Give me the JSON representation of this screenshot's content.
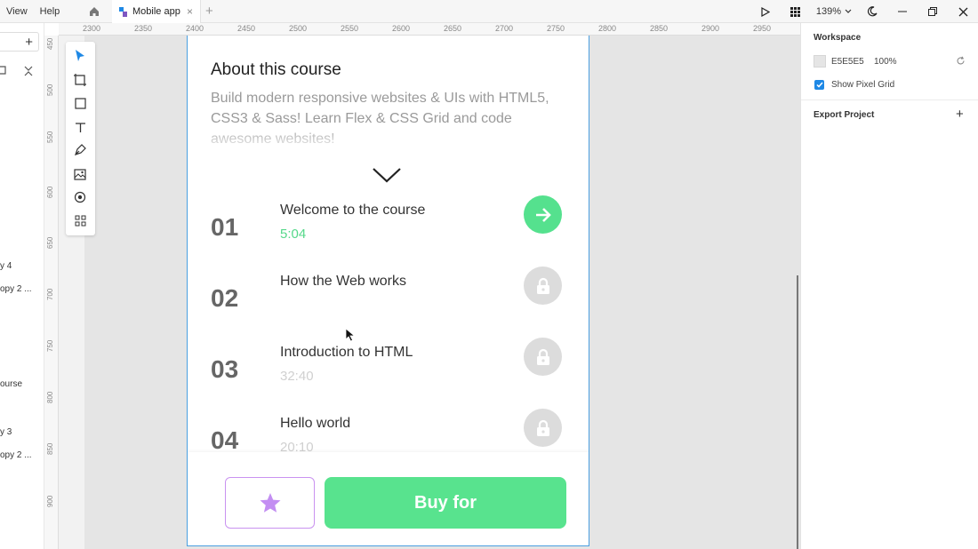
{
  "menu": [
    "View",
    "Help"
  ],
  "tab": {
    "title": "Mobile app",
    "close": "×"
  },
  "new_tab": "+",
  "zoom": {
    "value": "139%"
  },
  "left_panel": {
    "add": "+",
    "layers": [
      "y 4",
      "opy 2 ...",
      "ourse",
      "y 3",
      "opy 2 ..."
    ]
  },
  "ruler": {
    "horizontal": [
      "2300",
      "2350",
      "2400",
      "2450",
      "2500",
      "2550",
      "2600",
      "2650",
      "2700",
      "2750",
      "2800",
      "2850",
      "2900",
      "2950"
    ],
    "vertical": [
      "450",
      "500",
      "550",
      "600",
      "650",
      "700",
      "750",
      "800",
      "850",
      "900"
    ]
  },
  "artboard": {
    "about_title": "About this course",
    "about_desc": "Build modern responsive websites & UIs with HTML5, CSS3 & Sass! Learn Flex & CSS Grid and code awesome websites!",
    "lessons": [
      {
        "num": "01",
        "title": "Welcome to the course",
        "time": "5:04",
        "state": "active"
      },
      {
        "num": "02",
        "title": "How the Web works",
        "time": "",
        "state": "locked"
      },
      {
        "num": "03",
        "title": "Introduction to HTML",
        "time": "32:40",
        "state": "locked"
      },
      {
        "num": "04",
        "title": "Hello world",
        "time": "20:10",
        "state": "locked"
      }
    ],
    "buy_label": "Buy for"
  },
  "right_panel": {
    "workspace_heading": "Workspace",
    "color_hex": "E5E5E5",
    "opacity": "100%",
    "pixel_grid_label": "Show Pixel Grid",
    "export_heading": "Export Project",
    "export_add": "+"
  },
  "colors": {
    "accent_green": "#55e18e",
    "selection_blue": "#4a9fe0",
    "star_purple": "#c38ef2"
  }
}
